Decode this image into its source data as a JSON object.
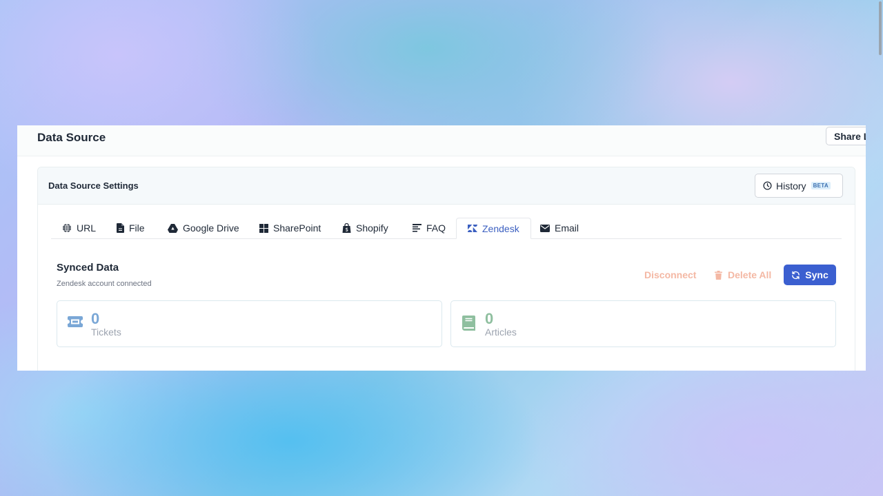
{
  "header": {
    "title": "Data Source",
    "share_label": "Share L"
  },
  "settings": {
    "title": "Data Source Settings",
    "history_label": "History",
    "history_badge": "BETA"
  },
  "tabs": [
    {
      "label": "URL",
      "icon": "globe-icon"
    },
    {
      "label": "File",
      "icon": "file-icon"
    },
    {
      "label": "Google Drive",
      "icon": "google-drive-icon"
    },
    {
      "label": "SharePoint",
      "icon": "sharepoint-icon"
    },
    {
      "label": "Shopify",
      "icon": "shopify-icon"
    },
    {
      "label": "FAQ",
      "icon": "faq-icon"
    },
    {
      "label": "Zendesk",
      "icon": "zendesk-icon",
      "active": true
    },
    {
      "label": "Email",
      "icon": "envelope-icon"
    }
  ],
  "synced": {
    "title": "Synced Data",
    "subtitle": "Zendesk account connected",
    "disconnect_label": "Disconnect",
    "delete_all_label": "Delete All",
    "sync_label": "Sync"
  },
  "stats": [
    {
      "value": "0",
      "label": "Tickets",
      "icon": "ticket-icon",
      "color": "#7aa7d6"
    },
    {
      "value": "0",
      "label": "Articles",
      "icon": "book-icon",
      "color": "#8fbf9f"
    }
  ],
  "colors": {
    "accent": "#3b5fd0",
    "active_tab": "#3b5fc0",
    "danger_muted": "#f4b8a4"
  }
}
